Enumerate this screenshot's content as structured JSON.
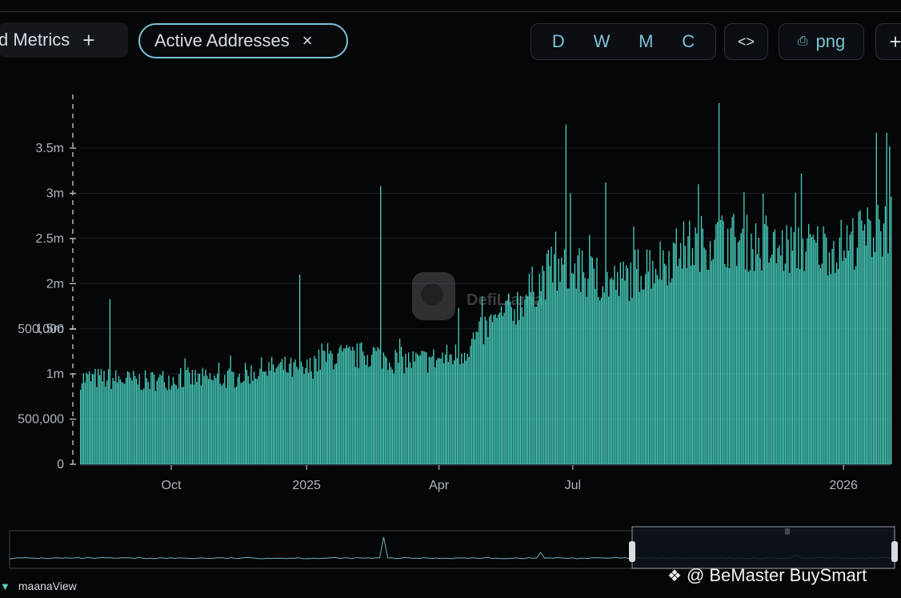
{
  "toolbar": {
    "metrics_label": "d Metrics",
    "metrics_add": "+",
    "active_label": "Active Addresses",
    "active_close": "×",
    "ranges": [
      "D",
      "W",
      "M",
      "C"
    ],
    "embed_label": "<>",
    "png_label": "png",
    "more_label": "+"
  },
  "watermark": "DefiLlama",
  "footer": {
    "brand": "maanaView",
    "credit": "@ BeMaster BuySmart"
  },
  "colors": {
    "bar": "#48d1c0",
    "background": "#050608",
    "accent": "#7cc3d6"
  },
  "chart_data": {
    "type": "bar",
    "title": "",
    "xlabel": "",
    "ylabel": "",
    "y_tick_labels": [
      "3.5m",
      "3m",
      "2.5m",
      "2m",
      "1.5m",
      "1m",
      "500,000",
      "500,000",
      "0"
    ],
    "y_tick_values": [
      3500000,
      3000000,
      2500000,
      2000000,
      1500000,
      1000000,
      1000000,
      500000,
      0
    ],
    "ylim": [
      0,
      4050000
    ],
    "x_tick_labels": [
      "Oct",
      "2025",
      "Apr",
      "Jul",
      "2026"
    ],
    "x_tick_dates": [
      "2024-10-01",
      "2025-01-01",
      "2025-04-01",
      "2025-07-01",
      "2026-01-01"
    ],
    "x_range": [
      "2024-07-31",
      "2026-02-02"
    ],
    "series": [
      {
        "trend_dates": [
          "2024-07-31",
          "2024-08-15",
          "2024-09-01",
          "2024-09-15",
          "2024-10-01",
          "2024-10-15",
          "2024-11-01",
          "2024-11-15",
          "2024-12-01",
          "2024-12-15",
          "2024-12-30",
          "2025-01-15",
          "2025-02-01",
          "2025-02-15",
          "2025-03-01",
          "2025-03-15",
          "2025-04-01",
          "2025-04-15",
          "2025-05-01",
          "2025-05-15",
          "2025-06-01",
          "2025-06-15",
          "2025-07-01",
          "2025-07-15",
          "2025-08-01",
          "2025-08-15",
          "2025-09-01",
          "2025-09-15",
          "2025-10-01",
          "2025-10-15",
          "2025-11-01",
          "2025-11-15",
          "2025-12-01",
          "2025-12-15",
          "2026-01-01",
          "2026-01-15",
          "2026-02-02"
        ],
        "trend_values": [
          960000,
          960000,
          940000,
          930000,
          960000,
          960000,
          950000,
          980000,
          1060000,
          1080000,
          1040000,
          1210000,
          1200000,
          1240000,
          1170000,
          1150000,
          1180000,
          1230000,
          1500000,
          1640000,
          1930000,
          2160000,
          2160000,
          2090000,
          2020000,
          2180000,
          2280000,
          2430000,
          2500000,
          2520000,
          2460000,
          2390000,
          2430000,
          2420000,
          2450000,
          2560000,
          2680000
        ],
        "spike_dates": [
          "2024-08-20",
          "2024-12-27",
          "2025-02-20",
          "2025-04-14",
          "2025-06-26",
          "2025-06-29",
          "2025-07-23",
          "2025-09-24",
          "2025-10-08",
          "2025-12-03",
          "2026-01-23",
          "2026-01-30",
          "2026-02-01"
        ],
        "spike_values": [
          1830000,
          2100000,
          3080000,
          1730000,
          3760000,
          3000000,
          3120000,
          3100000,
          4000000,
          3220000,
          3670000,
          3670000,
          3520000
        ]
      }
    ],
    "legend": "none",
    "grid": "horizontal"
  }
}
